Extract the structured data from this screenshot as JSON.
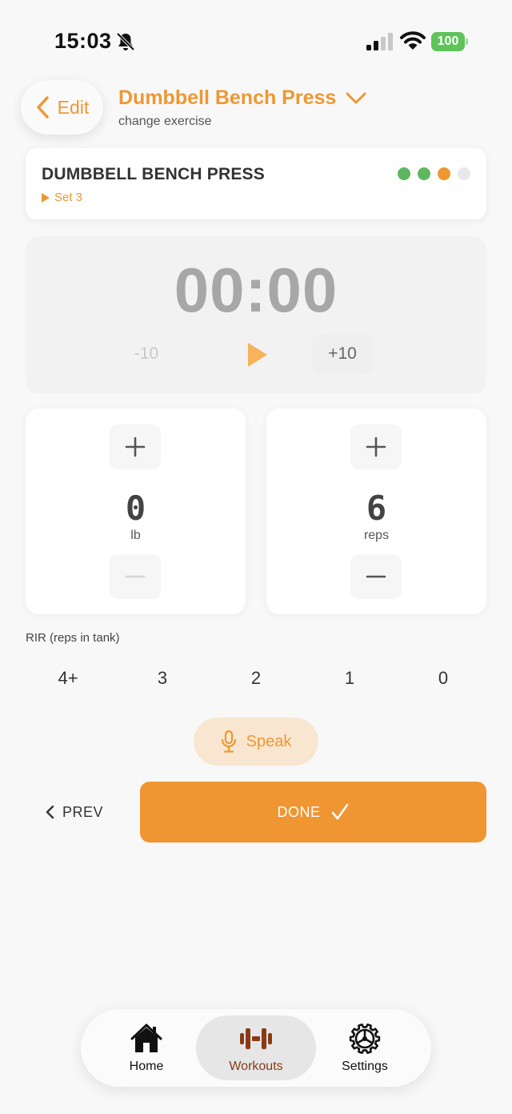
{
  "status_bar": {
    "time": "15:03",
    "battery": "100",
    "icons": [
      "bell-slash-icon",
      "signal-icon",
      "wifi-icon",
      "battery-icon"
    ]
  },
  "header": {
    "edit_label": "Edit",
    "exercise_name": "Dumbbell Bench Press",
    "subtitle": "change exercise"
  },
  "exercise_card": {
    "title": "DUMBBELL BENCH PRESS",
    "set_label": "Set 3",
    "set_dots": [
      {
        "status": "done",
        "color": "#5fb660"
      },
      {
        "status": "done",
        "color": "#5fb660"
      },
      {
        "status": "current",
        "color": "#ef9733"
      },
      {
        "status": "pending",
        "color": "#e8e8e8"
      }
    ]
  },
  "timer": {
    "display": "00:00",
    "minus_label": "-10",
    "plus_label": "+10"
  },
  "weight": {
    "value": "0",
    "unit": "lb"
  },
  "reps": {
    "value": "6",
    "unit": "reps"
  },
  "rir": {
    "label": "RIR (reps in tank)",
    "options": [
      "4+",
      "3",
      "2",
      "1",
      "0"
    ]
  },
  "speak_label": "Speak",
  "nav": {
    "prev_label": "PREV",
    "done_label": "DONE"
  },
  "tabs": [
    {
      "label": "Home",
      "icon": "home-icon",
      "active": false
    },
    {
      "label": "Workouts",
      "icon": "dumbbell-icon",
      "active": true
    },
    {
      "label": "Settings",
      "icon": "gear-icon",
      "active": false
    }
  ],
  "colors": {
    "accent": "#ef9733",
    "accent_soft": "#f8e6d0",
    "done_dot": "#5fb660",
    "active_tab_text": "#8a3a14",
    "timer_text": "#a7a7a7"
  }
}
